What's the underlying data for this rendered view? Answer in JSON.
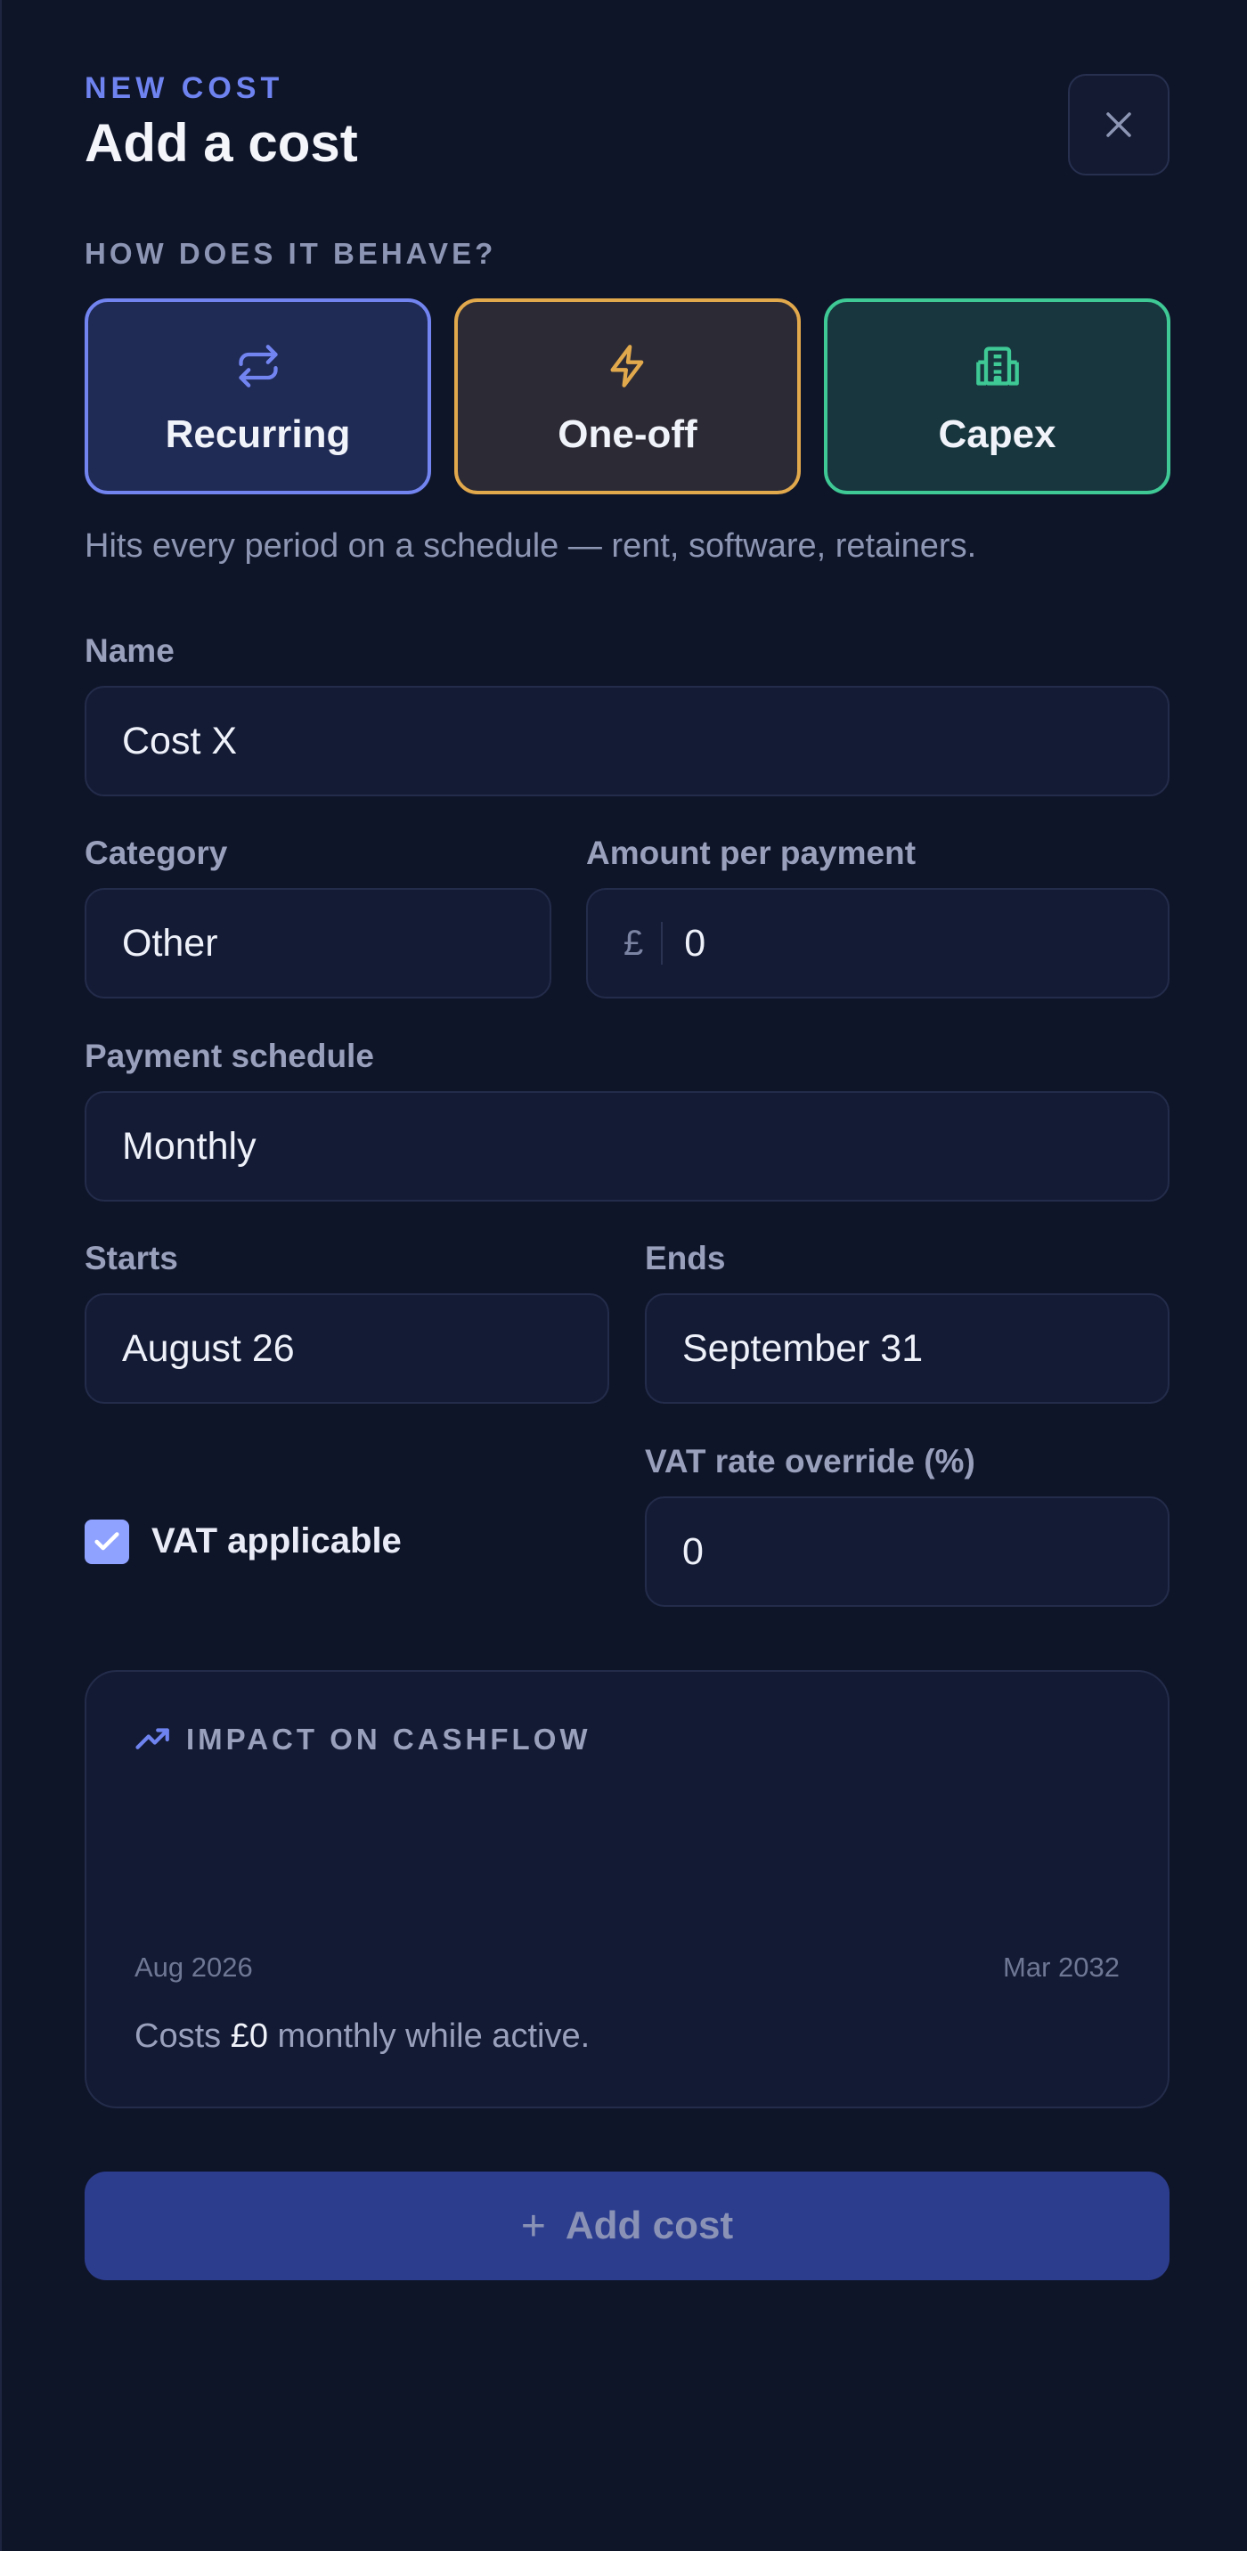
{
  "header": {
    "eyebrow": "NEW COST",
    "title": "Add a cost",
    "close_icon": "close-icon"
  },
  "behaviour": {
    "label": "HOW DOES IT BEHAVE?",
    "options": [
      {
        "label": "Recurring",
        "icon": "repeat-icon",
        "color": "#7184f0",
        "selected": true
      },
      {
        "label": "One-off",
        "icon": "lightning-icon",
        "color": "#e2a84c"
      },
      {
        "label": "Capex",
        "icon": "building-icon",
        "color": "#3ec995"
      }
    ],
    "hint": "Hits every period on a schedule — rent, software, retainers."
  },
  "form": {
    "name_label": "Name",
    "name_value": "Cost X",
    "category_label": "Category",
    "category_value": "Other",
    "amount_label": "Amount per payment",
    "currency": "£",
    "amount_value": "0",
    "schedule_label": "Payment schedule",
    "schedule_value": "Monthly",
    "starts_label": "Starts",
    "starts_value": "August 26",
    "ends_label": "Ends",
    "ends_value": "September 31",
    "vat_label": "VAT applicable",
    "vat_checked": true,
    "vat_rate_label": "VAT rate override (%)",
    "vat_rate_value": "0"
  },
  "impact": {
    "icon": "trend-up-icon",
    "title": "IMPACT ON CASHFLOW",
    "start": "Aug 2026",
    "end": "Mar 2032",
    "summary_prefix": "Costs ",
    "summary_amount": "£0",
    "summary_suffix": " monthly while active."
  },
  "actions": {
    "submit_label": "Add cost",
    "submit_icon": "plus-icon"
  },
  "colors": {
    "accent": "#6f83f0",
    "background": "#0f1529"
  }
}
